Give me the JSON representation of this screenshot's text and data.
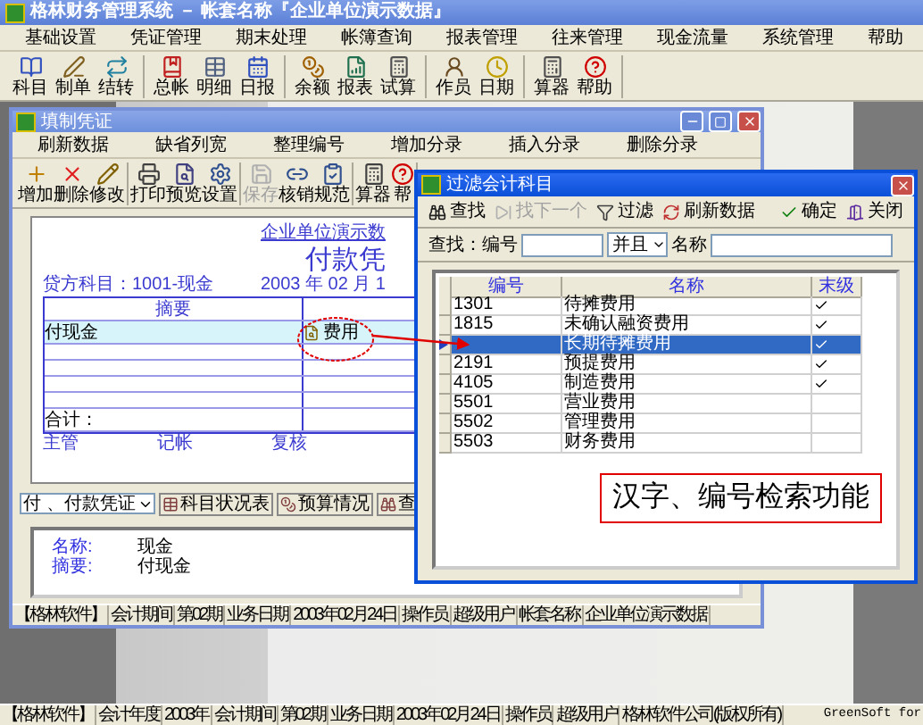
{
  "app": {
    "title": "格林财务管理系统 － 帐套名称『企业单位演示数据』"
  },
  "menu": [
    "基础设置",
    "凭证管理",
    "期末处理",
    "帐簿查询",
    "报表管理",
    "往来管理",
    "现金流量",
    "系统管理",
    "帮助"
  ],
  "toolbar": [
    [
      "科目",
      "制单",
      "结转"
    ],
    [
      "总帐",
      "明细",
      "日报"
    ],
    [
      "余额",
      "报表",
      "试算"
    ],
    [
      "作员",
      "日期"
    ],
    [
      "算器",
      "帮助"
    ]
  ],
  "voucher_window": {
    "title": "填制凭证",
    "menu": [
      "刷新数据",
      "缺省列宽",
      "整理编号",
      "增加分录",
      "插入分录",
      "删除分录"
    ],
    "toolbar": [
      [
        {
          "label": "增加",
          "disabled": false
        },
        {
          "label": "删除",
          "disabled": false
        },
        {
          "label": "修改",
          "disabled": false
        }
      ],
      [
        {
          "label": "打印",
          "disabled": false
        },
        {
          "label": "预览",
          "disabled": false
        },
        {
          "label": "设置",
          "disabled": false
        }
      ],
      [
        {
          "label": "保存",
          "disabled": true
        },
        {
          "label": "核销",
          "disabled": false
        },
        {
          "label": "规范",
          "disabled": false
        }
      ],
      [
        {
          "label": "算器",
          "disabled": false
        },
        {
          "label": "帮",
          "disabled": false
        }
      ]
    ],
    "company": "企业单位演示数",
    "voucher_title": "付款凭",
    "credit_account": "贷方科目：1001-现金",
    "date": "2003 年 02 月 1",
    "table": {
      "header": "摘要",
      "rows": [
        {
          "summary": "付现金",
          "account": "费用"
        },
        {},
        {},
        {},
        {}
      ],
      "total": "合计："
    },
    "signatures": [
      "主管",
      "记帐",
      "复核"
    ],
    "type_select": "付 、付款凭证",
    "buttons": [
      "科目状况表",
      "预算情况",
      "查"
    ],
    "info": [
      {
        "label": "名称:",
        "value": "现金"
      },
      {
        "label": "摘要:",
        "value": "付现金"
      }
    ],
    "status_bar": [
      "【格林软件】",
      "会计期间",
      "第02期",
      "业务日期",
      "2003年02月24日",
      "操作员",
      "超级用户",
      "帐套名称",
      "企业单位演示数据"
    ]
  },
  "dialog": {
    "title": "过滤会计科目",
    "tools": [
      {
        "label": "查找",
        "disabled": false
      },
      {
        "label": "找下一个",
        "disabled": true
      },
      {
        "label": "过滤",
        "disabled": false
      },
      {
        "label": "刷新数据",
        "disabled": false
      },
      {
        "label": "确定",
        "disabled": false
      },
      {
        "label": "关闭",
        "disabled": false
      }
    ],
    "search": {
      "label": "查找：编号",
      "operator": "并且",
      "name_label": "名称"
    },
    "columns": [
      "编号",
      "名称",
      "末级"
    ],
    "rows": [
      {
        "code": "1301",
        "name": "待摊费用",
        "leaf": true,
        "selected": false
      },
      {
        "code": "1815",
        "name": "未确认融资费用",
        "leaf": true,
        "selected": false
      },
      {
        "name": "长期待摊费用",
        "leaf": true,
        "selected": true
      },
      {
        "code": "2191",
        "name": "预提费用",
        "leaf": true,
        "selected": false
      },
      {
        "code": "4105",
        "name": "制造费用",
        "leaf": true,
        "selected": false
      },
      {
        "code": "5501",
        "name": "营业费用",
        "leaf": false,
        "selected": false
      },
      {
        "code": "5502",
        "name": "管理费用",
        "leaf": false,
        "selected": false
      },
      {
        "code": "5503",
        "name": "财务费用",
        "leaf": false,
        "selected": false
      }
    ],
    "callout": "汉字、编号检索功能"
  },
  "status_bar": [
    "【格林软件】",
    "会计年度",
    "2003年",
    "会计期间",
    "第02期",
    "业务日期",
    "2003年02月24日",
    "操作员",
    "超级用户",
    "格林软件公司(版权所有)",
    "GreenSoft for"
  ]
}
